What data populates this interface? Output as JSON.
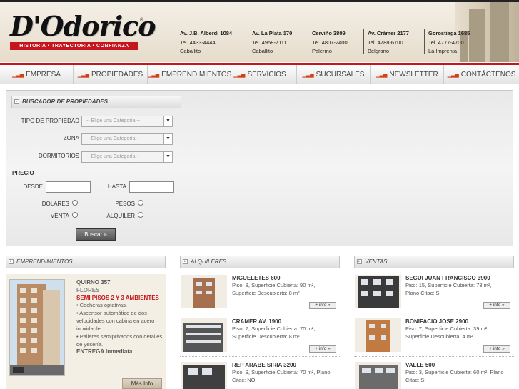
{
  "brand": {
    "name": "D'Odorico",
    "tagline": "HISTORIA • TRAYECTORIA • CONFIANZA",
    "reg": "®"
  },
  "branches": [
    {
      "address": "Av. J.B. Alberdi 1084",
      "phone": "Tel. 4433-4444",
      "area": "Caballito"
    },
    {
      "address": "Av. La Plata 170",
      "phone": "Tel. 4958-7111",
      "area": "Caballito"
    },
    {
      "address": "Cerviño 3809",
      "phone": "Tel. 4807-2400",
      "area": "Palermo"
    },
    {
      "address": "Av. Crámer 2177",
      "phone": "Tel. 4788-6700",
      "area": "Belgrano"
    },
    {
      "address": "Gorostiaga 1685",
      "phone": "Tel. 4777-4700",
      "area": "La Imprenta"
    }
  ],
  "nav": [
    "EMPRESA",
    "PROPIEDADES",
    "EMPRENDIMIENTOS",
    "SERVICIOS",
    "SUCURSALES",
    "NEWSLETTER",
    "CONTÁCTENOS"
  ],
  "search": {
    "title": "BUSCADOR DE PROPIEDADES",
    "tipo_label": "TIPO DE PROPIEDAD",
    "zona_label": "ZONA",
    "dorm_label": "DORMITORIOS",
    "select_placeholder": "-- Elige una Categoría --",
    "precio_label": "PRECIO",
    "desde_label": "DESDE",
    "hasta_label": "HASTA",
    "dolares_label": "DOLARES",
    "pesos_label": "PESOS",
    "venta_label": "VENTA",
    "alquiler_label": "ALQUILER",
    "button_label": "Buscar »"
  },
  "emprendimientos": {
    "title": "EMPRENDIMIENTOS",
    "name": "QUIRNO 357",
    "area": "FLORES",
    "headline": "SEMI PISOS 2 Y 3 AMBIENTES",
    "features": [
      "• Cocheras optativas.",
      "• Ascensor automático de dos velocidades con cabina en acero inoxidable.",
      "• Palieres semiprivados con detalles de yesería."
    ],
    "delivery": "ENTREGA Inmediata",
    "more_label": "Más Info"
  },
  "alquileres": {
    "title": "ALQUILERES",
    "items": [
      {
        "name": "MIGUELETES 600",
        "line1": "Piso: 8, Superficie Cubierta: 90 m²,",
        "line2": "Superficie Descubierta: 8 m²"
      },
      {
        "name": "CRAMER AV. 1900",
        "line1": "Piso: 7, Superficie Cubierta: 70 m²,",
        "line2": "Superficie Descubierta: 8 m²"
      },
      {
        "name": "REP ARABE SIRIA 3200",
        "line1": "Piso: 9, Superficie Cubierta: 70 m², Plano",
        "line2": "Citac: NO"
      }
    ]
  },
  "ventas": {
    "title": "VENTAS",
    "items": [
      {
        "name": "SEGUI JUAN FRANCISCO 3900",
        "line1": "Piso: 15, Superficie Cubierta: 73 m²,",
        "line2": "Plano Citac: SI"
      },
      {
        "name": "BONIFACIO JOSE 2900",
        "line1": "Piso: 7, Superficie Cubierta: 39 m²,",
        "line2": "Superficie Descubierta: 4 m²"
      },
      {
        "name": "VALLE 500",
        "line1": "Piso: 3, Superficie Cubierta: 60 m², Plano",
        "line2": "Citac: SI"
      }
    ]
  },
  "info_label": "+ info »",
  "colors": {
    "brand_red": "#c4161c",
    "accent_red": "#d2401a"
  }
}
